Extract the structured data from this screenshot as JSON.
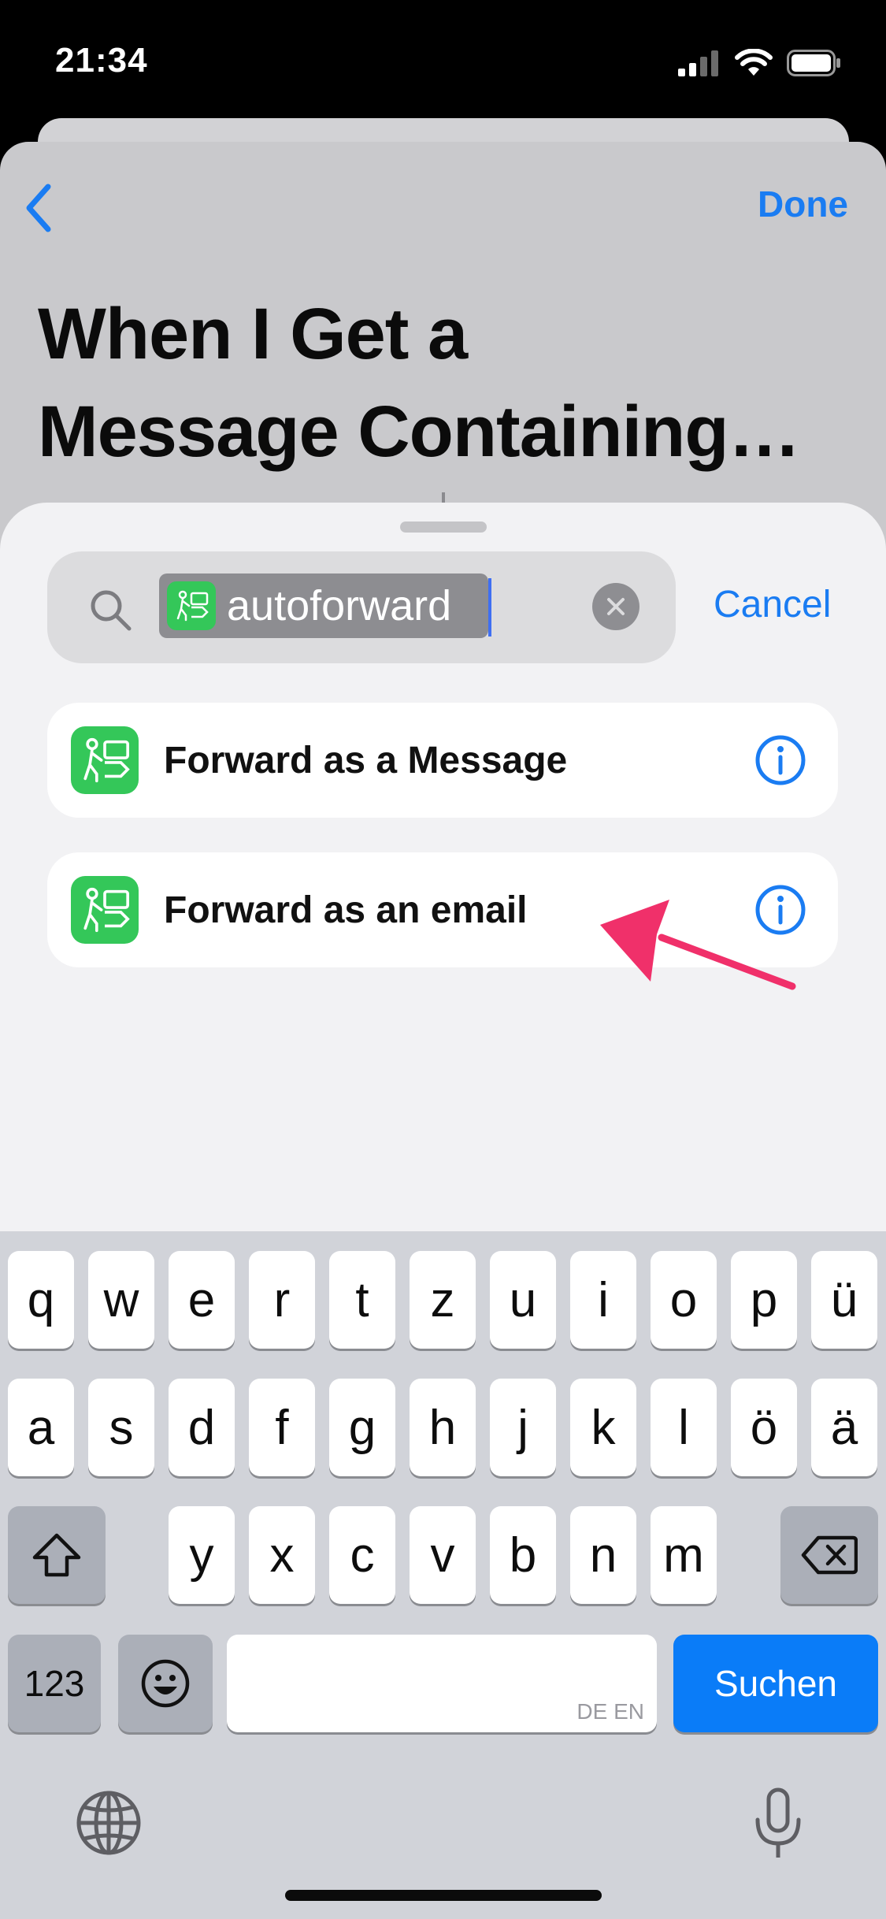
{
  "status_bar": {
    "time": "21:34"
  },
  "nav": {
    "done_label": "Done"
  },
  "page": {
    "title_line1": "When I Get a",
    "title_line2": "Message Containing…"
  },
  "search": {
    "query": "autoforward",
    "cancel_label": "Cancel"
  },
  "results": [
    {
      "label": "Forward as a Message"
    },
    {
      "label": "Forward as an email"
    }
  ],
  "keyboard": {
    "row1": [
      "q",
      "w",
      "e",
      "r",
      "t",
      "z",
      "u",
      "i",
      "o",
      "p",
      "ü"
    ],
    "row2": [
      "a",
      "s",
      "d",
      "f",
      "g",
      "h",
      "j",
      "k",
      "l",
      "ö",
      "ä"
    ],
    "row3": [
      "y",
      "x",
      "c",
      "v",
      "b",
      "n",
      "m"
    ],
    "numbers_label": "123",
    "space_hint": "DE EN",
    "search_label": "Suchen"
  },
  "colors": {
    "accent": "#1a7cf2",
    "app_icon": "#34c759",
    "arrow": "#f0306a",
    "search_key": "#0a7cf8"
  },
  "icons": [
    "search-icon",
    "clear-icon",
    "info-icon",
    "chevron-left-icon",
    "shift-icon",
    "delete-icon",
    "emoji-icon",
    "globe-icon",
    "microphone-icon"
  ]
}
